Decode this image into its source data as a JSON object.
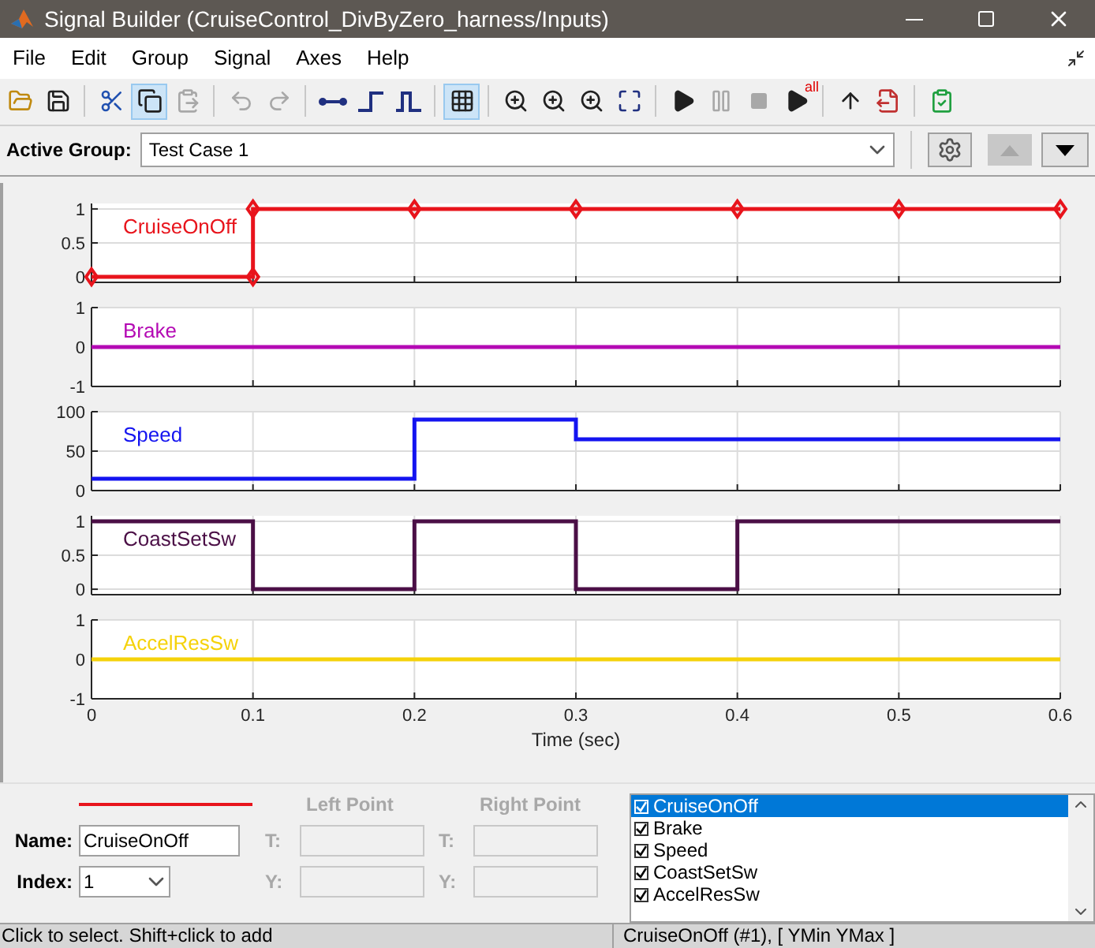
{
  "window": {
    "title": "Signal Builder (CruiseControl_DivByZero_harness/Inputs)"
  },
  "menu": [
    "File",
    "Edit",
    "Group",
    "Signal",
    "Axes",
    "Help"
  ],
  "toolbar": [
    {
      "kind": "open",
      "disabled": false,
      "selected": false
    },
    {
      "kind": "save",
      "disabled": false,
      "selected": false
    },
    {
      "kind": "sep"
    },
    {
      "kind": "cut",
      "disabled": false,
      "selected": false
    },
    {
      "kind": "copy",
      "disabled": false,
      "selected": true
    },
    {
      "kind": "paste",
      "disabled": true,
      "selected": false
    },
    {
      "kind": "sep"
    },
    {
      "kind": "undo",
      "disabled": true,
      "selected": false
    },
    {
      "kind": "redo",
      "disabled": true,
      "selected": false
    },
    {
      "kind": "sep"
    },
    {
      "kind": "segment",
      "disabled": false,
      "selected": false
    },
    {
      "kind": "step",
      "disabled": false,
      "selected": false
    },
    {
      "kind": "pulse",
      "disabled": false,
      "selected": false
    },
    {
      "kind": "sep"
    },
    {
      "kind": "grid",
      "disabled": false,
      "selected": true
    },
    {
      "kind": "sep"
    },
    {
      "kind": "zoomx",
      "disabled": false,
      "selected": false
    },
    {
      "kind": "zoomy",
      "disabled": false,
      "selected": false
    },
    {
      "kind": "zoomxy",
      "disabled": false,
      "selected": false
    },
    {
      "kind": "fit",
      "disabled": false,
      "selected": false
    },
    {
      "kind": "sep"
    },
    {
      "kind": "play",
      "disabled": false,
      "selected": false
    },
    {
      "kind": "pause",
      "disabled": true,
      "selected": false
    },
    {
      "kind": "stop",
      "disabled": true,
      "selected": false
    },
    {
      "kind": "playall",
      "disabled": false,
      "selected": false,
      "badge": "all"
    },
    {
      "kind": "sep"
    },
    {
      "kind": "up",
      "disabled": false,
      "selected": false
    },
    {
      "kind": "export",
      "disabled": false,
      "selected": false
    },
    {
      "kind": "sep"
    },
    {
      "kind": "check",
      "disabled": false,
      "selected": false
    }
  ],
  "active_group": {
    "label": "Active Group:",
    "value": "Test Case 1",
    "move_up_disabled": true
  },
  "axes": [
    {
      "chart_data": {
        "type": "line",
        "x": [
          0,
          0.1,
          0.1,
          0.2,
          0.3,
          0.4,
          0.5,
          0.6
        ],
        "series": [
          {
            "name": "CruiseOnOff",
            "color": "#e8141c",
            "marker": "diamond",
            "values": [
              0,
              0,
              1,
              1,
              1,
              1,
              1,
              1
            ]
          }
        ],
        "xlim": [
          0,
          0.6
        ],
        "ylim": [
          -0.08,
          1.08
        ],
        "yticks": [
          0,
          0.5,
          1
        ],
        "grid": true
      }
    },
    {
      "chart_data": {
        "type": "line",
        "x": [
          0,
          0.6
        ],
        "series": [
          {
            "name": "Brake",
            "color": "#b40ab4",
            "values": [
              0,
              0
            ]
          }
        ],
        "xlim": [
          0,
          0.6
        ],
        "ylim": [
          -1,
          1
        ],
        "yticks": [
          -1,
          0,
          1
        ],
        "grid": true
      }
    },
    {
      "chart_data": {
        "type": "line",
        "x": [
          0,
          0.2,
          0.2,
          0.3,
          0.3,
          0.6
        ],
        "series": [
          {
            "name": "Speed",
            "color": "#1414f0",
            "values": [
              15,
              15,
              90,
              90,
              65,
              65
            ]
          }
        ],
        "xlim": [
          0,
          0.6
        ],
        "ylim": [
          0,
          100
        ],
        "yticks": [
          0,
          50,
          100
        ],
        "grid": true
      }
    },
    {
      "chart_data": {
        "type": "line",
        "x": [
          0,
          0.1,
          0.1,
          0.2,
          0.2,
          0.3,
          0.3,
          0.4,
          0.4,
          0.6
        ],
        "series": [
          {
            "name": "CoastSetSw",
            "color": "#4b0f46",
            "values": [
              1,
              1,
              0,
              0,
              1,
              1,
              0,
              0,
              1,
              1
            ]
          }
        ],
        "xlim": [
          0,
          0.6
        ],
        "ylim": [
          -0.08,
          1.08
        ],
        "yticks": [
          0,
          0.5,
          1
        ],
        "grid": true
      }
    },
    {
      "chart_data": {
        "type": "line",
        "xlabel": "Time (sec)",
        "x": [
          0,
          0.6
        ],
        "series": [
          {
            "name": "AccelResSw",
            "color": "#f5d20a",
            "values": [
              0,
              0
            ]
          }
        ],
        "xlim": [
          0,
          0.6
        ],
        "ylim": [
          -1,
          1
        ],
        "xticks": [
          0,
          0.1,
          0.2,
          0.3,
          0.4,
          0.5,
          0.6
        ],
        "yticks": [
          -1,
          0,
          1
        ],
        "grid": true
      }
    }
  ],
  "signal_editor": {
    "name_label": "Name:",
    "name": "CruiseOnOff",
    "index_label": "Index:",
    "index": "1",
    "left_point": {
      "title": "Left Point",
      "t_label": "T:",
      "y_label": "Y:",
      "disabled": true
    },
    "right_point": {
      "title": "Right Point",
      "t_label": "T:",
      "y_label": "Y:",
      "disabled": true
    }
  },
  "signals": [
    {
      "label": "CruiseOnOff",
      "checked": true,
      "selected": true
    },
    {
      "label": "Brake",
      "checked": true,
      "selected": false
    },
    {
      "label": "Speed",
      "checked": true,
      "selected": false
    },
    {
      "label": "CoastSetSw",
      "checked": true,
      "selected": false
    },
    {
      "label": "AccelResSw",
      "checked": true,
      "selected": false
    }
  ],
  "status_bar": {
    "message": "Click to select. Shift+click to add",
    "selection": "CruiseOnOff (#1), [ YMin YMax ]"
  }
}
